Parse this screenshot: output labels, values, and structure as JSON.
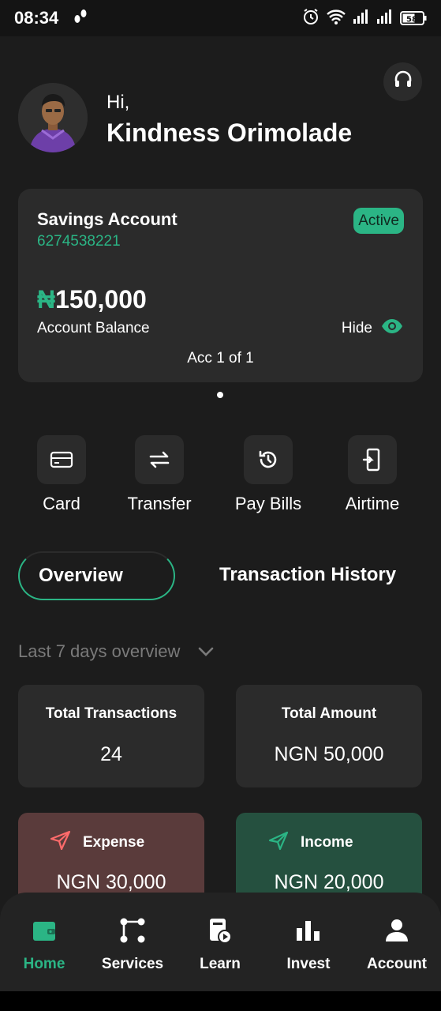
{
  "status_bar": {
    "time": "08:34",
    "battery": "58"
  },
  "header": {
    "greeting": "Hi,",
    "user_name": "Kindness Orimolade"
  },
  "account": {
    "type": "Savings Account",
    "number": "6274538221",
    "status": "Active",
    "currency_symbol": "₦",
    "balance": "150,000",
    "balance_label": "Account Balance",
    "hide_label": "Hide",
    "pager": "Acc 1 of 1"
  },
  "actions": [
    {
      "label": "Card",
      "icon": "card-icon"
    },
    {
      "label": "Transfer",
      "icon": "transfer-icon"
    },
    {
      "label": "Pay Bills",
      "icon": "history-icon"
    },
    {
      "label": "Airtime",
      "icon": "phone-icon"
    }
  ],
  "tabs": {
    "overview": "Overview",
    "history": "Transaction History"
  },
  "period": {
    "selected": "Last 7 days overview"
  },
  "stats": {
    "total_transactions_label": "Total Transactions",
    "total_transactions_value": "24",
    "total_amount_label": "Total Amount",
    "total_amount_value": "NGN 50,000"
  },
  "flows": {
    "expense_label": "Expense",
    "expense_value": "NGN 30,000",
    "income_label": "Income",
    "income_value": "NGN 20,000"
  },
  "nav": [
    {
      "label": "Home",
      "icon": "wallet-icon",
      "active": true
    },
    {
      "label": "Services",
      "icon": "services-icon"
    },
    {
      "label": "Learn",
      "icon": "learn-icon"
    },
    {
      "label": "Invest",
      "icon": "chart-icon"
    },
    {
      "label": "Account",
      "icon": "user-icon"
    }
  ],
  "colors": {
    "accent": "#2bb585",
    "background": "#1c1c1c",
    "card": "#2b2b2b",
    "expense": "#5a3b3b",
    "income": "#25503f"
  }
}
